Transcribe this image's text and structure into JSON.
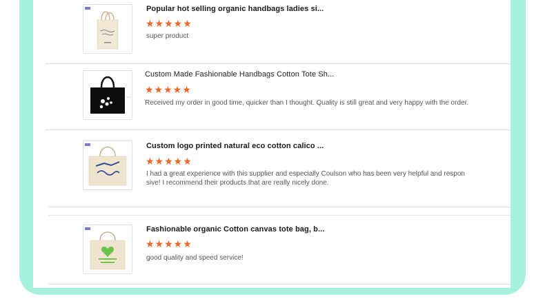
{
  "reviews": [
    {
      "title": "Popular hot selling organic handbags ladies si...",
      "stars": "★★★★★",
      "rating": 5,
      "comment": "super product",
      "image": "beige-tote-with-text-icon"
    },
    {
      "title": "Custom Made Fashionable Handbags Cotton Tote Sh...",
      "stars": "★★★★★",
      "rating": 5,
      "comment": "Received my order  in good time, quicker than I thought.  Quality is still great and very happy with the order.",
      "image": "black-tote-with-flowers-icon"
    },
    {
      "title": "Custom logo printed natural eco cotton calico ...",
      "stars": "★★★★★",
      "rating": 5,
      "comment": "I had a great experience with this supplier and especially Coulson who has been very helpful and responsive! I recommend their products that are really nicely done.",
      "image": "marine-print-tote-icon"
    },
    {
      "title": "Fashionable organic Cotton canvas tote bag, b...",
      "stars": "★★★★★",
      "rating": 5,
      "comment": "good quality and speed service!",
      "image": "farmers-print-tote-icon"
    }
  ],
  "colors": {
    "accent_frame": "#a8f0de",
    "star": "#f26522"
  }
}
